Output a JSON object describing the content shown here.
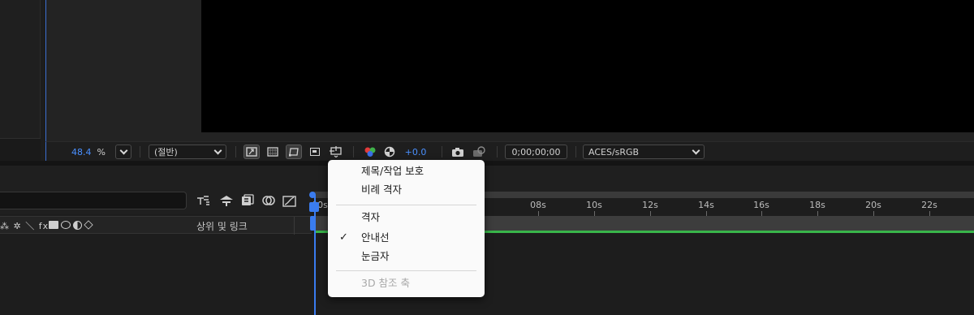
{
  "viewer": {
    "zoom_value": "48.4",
    "zoom_unit": "%",
    "resolution": "(절반)",
    "exposure": "+0.0",
    "timecode": "0;00;00;00",
    "color_space": "ACES/sRGB"
  },
  "timeline": {
    "parent_link_label": "상위 및 링크",
    "switch_icons": "⁂ ✲ ＼ fx",
    "ruler_labels": [
      "00s",
      "08s",
      "10s",
      "12s",
      "14s",
      "16s",
      "18s",
      "20s",
      "22s"
    ]
  },
  "context_menu": {
    "items": [
      {
        "label": "제목/작업 보호",
        "checked": false,
        "disabled": false
      },
      {
        "label": "비례 격자",
        "checked": false,
        "disabled": false
      },
      {
        "label": "격자",
        "checked": false,
        "disabled": false
      },
      {
        "label": "안내선",
        "checked": true,
        "disabled": false
      },
      {
        "label": "눈금자",
        "checked": false,
        "disabled": false
      },
      {
        "label": "3D 참조 축",
        "checked": false,
        "disabled": true
      }
    ],
    "check_glyph": "✓"
  },
  "colors": {
    "accent_blue": "#3a7cf0",
    "work_area_green": "#39b54a",
    "menu_bg": "#fafafa"
  }
}
